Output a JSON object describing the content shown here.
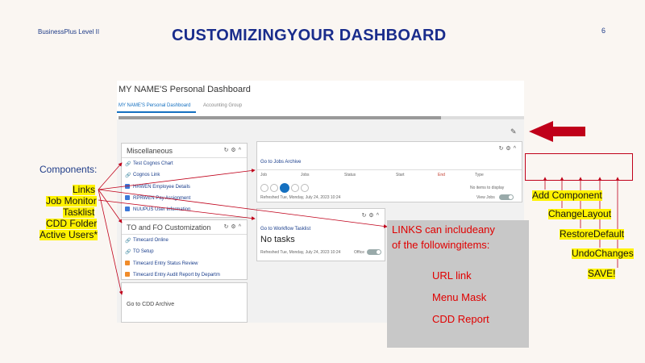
{
  "slide": {
    "subtitle": "BusinessPlus Level II",
    "title": "CUSTOMIZINGYOUR  DASHBOARD",
    "page_number": "6"
  },
  "dashboard": {
    "title": "MY NAME'S Personal Dashboard",
    "tabs": [
      {
        "label": "MY NAME'S Personal Dashboard",
        "active": true
      },
      {
        "label": "Accounting Group",
        "active": false
      }
    ],
    "miscellaneous": {
      "title": "Miscellaneous",
      "items": [
        {
          "label": "Test Cognos Chart",
          "icon": "link-icon"
        },
        {
          "label": "Cognos Link",
          "icon": "link-icon"
        },
        {
          "label": "HRWEN Employee Details",
          "icon": "menu-mask-icon"
        },
        {
          "label": "RPRWEN Pay Assignment",
          "icon": "menu-mask-icon"
        },
        {
          "label": "NUUPUS User Information",
          "icon": "menu-mask-icon"
        }
      ]
    },
    "to_customization": {
      "title": "TO and FO Customization",
      "items": [
        {
          "label": "Timecard Online",
          "icon": "link-icon"
        },
        {
          "label": "TO Setup",
          "icon": "link-icon"
        },
        {
          "label": "Timecard Entry Status Review",
          "icon": "report-icon"
        },
        {
          "label": "Timecard Entry Audit Report by Departm",
          "icon": "report-icon"
        }
      ]
    },
    "cdd_archive": {
      "title": "Go to CDD Archive"
    },
    "jobs_archive": {
      "title": "Go to Jobs Archive",
      "columns": [
        "Job",
        "Jobs",
        "Status",
        "Start",
        "End",
        "Type"
      ],
      "empty_text": "No items to display",
      "refreshed": "Refreshed Tue, Monday, July 24, 2023 10:24",
      "toggle_label": "View Jobs",
      "current_page": "1"
    },
    "workflow_tasklist": {
      "title": "Go to Workflow Tasklist",
      "status": "No tasks",
      "refreshed": "Refreshed Tue, Monday, July 24, 2023 10:24",
      "toggle_label": "Office"
    }
  },
  "annotations": {
    "components_label": "Components:",
    "component_types": [
      "Links",
      "Job Monitor",
      "Tasklist",
      "CDD Folder",
      "Active Users*"
    ],
    "toolbar_actions": [
      "Add Component",
      "ChangeLayout",
      "RestoreDefault",
      "UndoChanges",
      "SAVE!"
    ],
    "links_box": {
      "intro_line1": "LINKS can includeany",
      "intro_line2": "of the followingitems:",
      "items": [
        "URL link",
        "Menu Mask",
        "CDD Report"
      ]
    }
  },
  "colors": {
    "title": "#1a2d8c",
    "highlight": "#fff200",
    "annotation_red": "#e00000",
    "arrow_red": "#c0001a",
    "link_blue": "#1570c0"
  }
}
